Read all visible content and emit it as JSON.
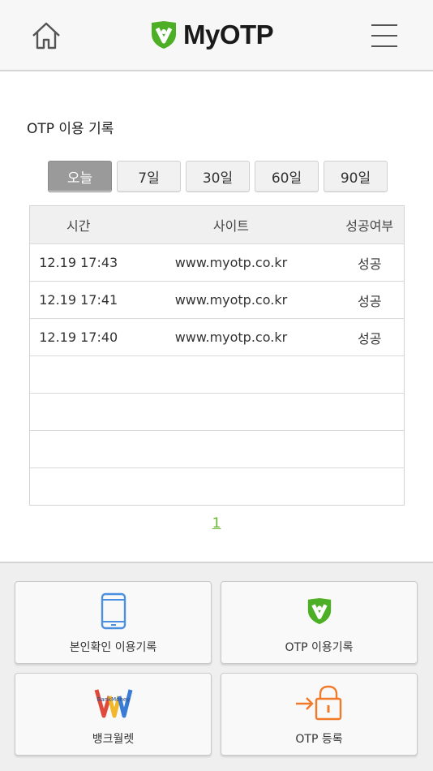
{
  "header": {
    "logo_text": "MyOTP",
    "brand_color": "#4caf26"
  },
  "page_title": "OTP 이용 기록",
  "tabs": [
    {
      "label": "오늘",
      "active": true
    },
    {
      "label": "7일",
      "active": false
    },
    {
      "label": "30일",
      "active": false
    },
    {
      "label": "60일",
      "active": false
    },
    {
      "label": "90일",
      "active": false
    }
  ],
  "table": {
    "headers": [
      "시간",
      "사이트",
      "성공여부"
    ],
    "rows": [
      [
        "12.19 17:43",
        "www.myotp.co.kr",
        "성공"
      ],
      [
        "12.19 17:41",
        "www.myotp.co.kr",
        "성공"
      ],
      [
        "12.19 17:40",
        "www.myotp.co.kr",
        "성공"
      ],
      [
        "",
        "",
        ""
      ],
      [
        "",
        "",
        ""
      ],
      [
        "",
        "",
        ""
      ],
      [
        "",
        "",
        ""
      ]
    ]
  },
  "pagination": {
    "pages": [
      "1"
    ]
  },
  "bottom_menu": [
    {
      "label": "본인확인 이용기록",
      "icon": "phone-icon"
    },
    {
      "label": "OTP 이용기록",
      "icon": "myotp-shield-icon"
    },
    {
      "label": "뱅크월렛",
      "icon": "bankwallet-logo-icon",
      "logo_text": "BankMoney"
    },
    {
      "label": "OTP 등록",
      "icon": "lock-arrow-icon"
    }
  ]
}
